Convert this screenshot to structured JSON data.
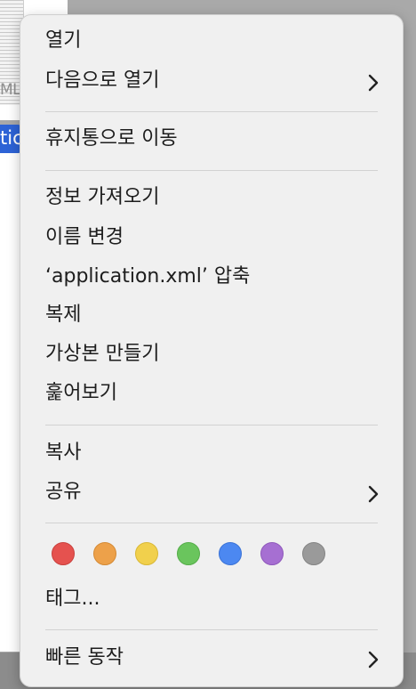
{
  "background": {
    "thumbnail_label": "ML",
    "file_label": "tic"
  },
  "menu": {
    "items": {
      "open": "열기",
      "open_with": "다음으로 열기",
      "move_to_trash": "휴지통으로 이동",
      "get_info": "정보 가져오기",
      "rename": "이름 변경",
      "compress": "‘application.xml’ 압축",
      "duplicate": "복제",
      "make_alias": "가상본 만들기",
      "quick_look": "훑어보기",
      "copy": "복사",
      "share": "공유",
      "tags": "태그...",
      "quick_actions": "빠른 동작"
    },
    "tag_colors": [
      {
        "name": "red",
        "fill": "#e5524f",
        "stroke": "#c9403d"
      },
      {
        "name": "orange",
        "fill": "#eda14a",
        "stroke": "#d48a35"
      },
      {
        "name": "yellow",
        "fill": "#f1d04c",
        "stroke": "#d9b836"
      },
      {
        "name": "green",
        "fill": "#6ac55d",
        "stroke": "#55ad49"
      },
      {
        "name": "blue",
        "fill": "#4c88f1",
        "stroke": "#3a72d6"
      },
      {
        "name": "purple",
        "fill": "#a66fd2",
        "stroke": "#8f58bb"
      },
      {
        "name": "gray",
        "fill": "#9a9a9a",
        "stroke": "#848484"
      }
    ]
  }
}
